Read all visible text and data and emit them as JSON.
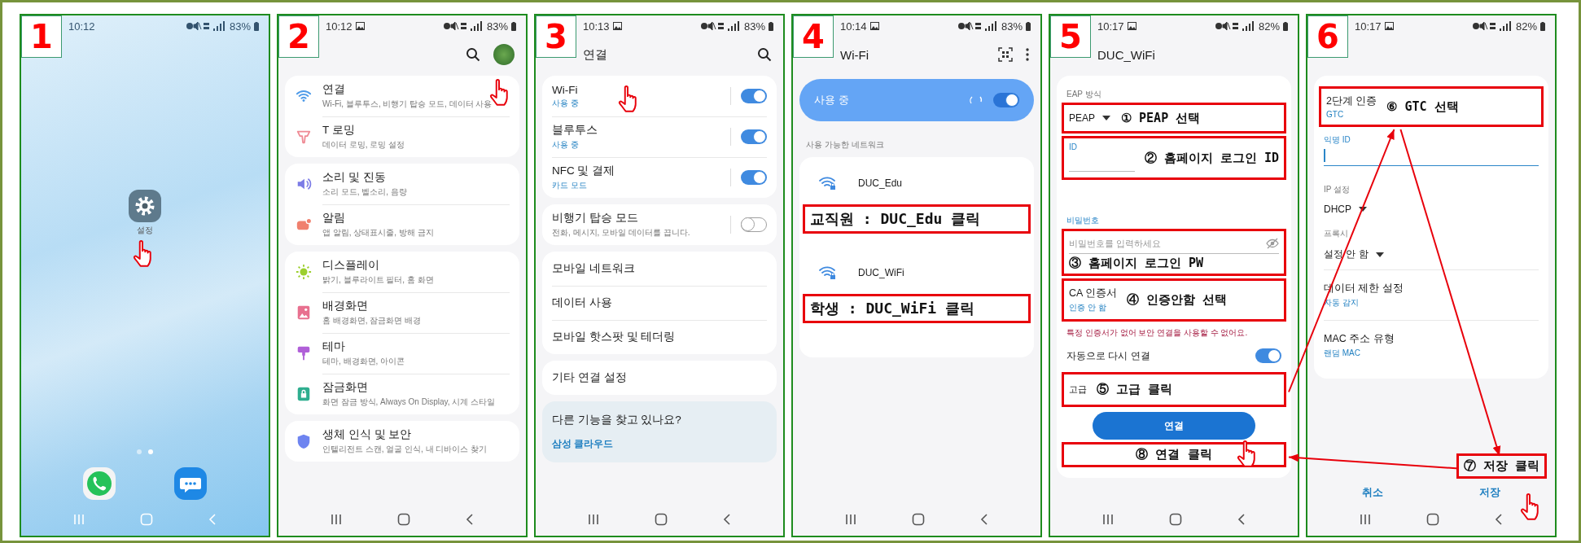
{
  "panels": [
    {
      "kind": "home",
      "number": "1",
      "status_bar": {
        "time": "10:12",
        "battery": "83%"
      },
      "app": {
        "label": "설정",
        "tapped": true
      },
      "page_dots": [
        {
          "selected": false
        },
        {
          "selected": true
        }
      ]
    },
    {
      "kind": "settings",
      "number": "2",
      "status_bar": {
        "time": "10:12",
        "battery": "83%"
      },
      "groups": [
        {
          "items": [
            {
              "title": "연결",
              "subtitle": "Wi-Fi, 블루투스, 비행기 탑승 모드, 데이터 사용",
              "color": "#4f9be8",
              "tapped": true
            },
            {
              "title": "T 로밍",
              "subtitle": "데이터 로밍, 로밍 설정",
              "color": "#ef8a94",
              "tapped": false
            }
          ]
        },
        {
          "items": [
            {
              "title": "소리 및 진동",
              "subtitle": "소리 모드, 벨소리, 음량",
              "color": "#7b7be6",
              "tapped": false
            },
            {
              "title": "알림",
              "subtitle": "앱 알림, 상태표시줄, 방해 금지",
              "color": "#f0806e",
              "tapped": false
            }
          ]
        },
        {
          "items": [
            {
              "title": "디스플레이",
              "subtitle": "밝기, 블루라이트 필터, 홈 화면",
              "color": "#9ccf2e",
              "tapped": false
            },
            {
              "title": "배경화면",
              "subtitle": "홈 배경화면, 잠금화면 배경",
              "color": "#e8708f",
              "tapped": false
            },
            {
              "title": "테마",
              "subtitle": "테마, 배경화면, 아이콘",
              "color": "#b05fd8",
              "tapped": false
            },
            {
              "title": "잠금화면",
              "subtitle": "화면 잠금 방식, Always On Display, 시계 스타일",
              "color": "#2fae8f",
              "tapped": false
            }
          ]
        },
        {
          "items": [
            {
              "title": "생체 인식 및 보안",
              "subtitle": "인텔리전트 스캔, 얼굴 인식, 내 디바이스 찾기",
              "color": "#6e84f0",
              "tapped": false
            }
          ]
        }
      ]
    },
    {
      "kind": "connections",
      "number": "3",
      "status_bar": {
        "time": "10:13",
        "battery": "83%"
      },
      "title": "연결",
      "groups": [
        {
          "items": [
            {
              "kind": "toggle",
              "title": "Wi-Fi",
              "subtitle": "사용 중",
              "on": true,
              "tapped": true
            },
            {
              "kind": "toggle",
              "title": "블루투스",
              "subtitle": "사용 중",
              "on": true,
              "tapped": false
            },
            {
              "kind": "toggle",
              "title": "NFC 및 결제",
              "subtitle": "카드 모드",
              "on": true,
              "tapped": false
            }
          ]
        },
        {
          "items": [
            {
              "kind": "toggle",
              "title": "비행기 탑승 모드",
              "subtitle": "전화, 메시지, 모바일 데이터를 끕니다.",
              "on": false,
              "tapped": false
            }
          ]
        },
        {
          "items": [
            {
              "kind": "link",
              "title": "모바일 네트워크",
              "tapped": false
            },
            {
              "kind": "link",
              "title": "데이터 사용",
              "tapped": false
            },
            {
              "kind": "link",
              "title": "모바일 핫스팟 및 테더링",
              "tapped": false
            }
          ]
        },
        {
          "items": [
            {
              "kind": "link",
              "title": "기타 연결 설정",
              "tapped": false
            }
          ]
        }
      ],
      "suggestion": {
        "question": "다른 기능을 찾고 있나요?",
        "link": "삼성 클라우드"
      }
    },
    {
      "kind": "wifi",
      "number": "4",
      "status_bar": {
        "time": "10:14",
        "battery": "83%"
      },
      "title": "Wi-Fi",
      "master": {
        "label": "사용 중",
        "on": true
      },
      "section": "사용 가능한 네트워크",
      "networks": [
        {
          "name": "DUC_Edu",
          "annotation": "교직원 : DUC_Edu 클릭"
        },
        {
          "name": "DUC_WiFi",
          "annotation": "학생 : DUC_WiFi 클릭"
        }
      ]
    },
    {
      "kind": "form",
      "number": "5",
      "status_bar": {
        "time": "10:17",
        "battery": "82%"
      },
      "title": "DUC_WiFi",
      "rows": [
        {
          "kind": "dropdown",
          "label": "EAP 방식",
          "value": "PEAP",
          "annotation": "① PEAP 선택"
        },
        {
          "kind": "field",
          "label": "ID",
          "focused": false,
          "annotation": "② 홈페이지 로그인 ID"
        },
        {
          "kind": "password",
          "label": "비밀번호",
          "placeholder": "비밀번호를 입력하세요",
          "annotation": "③ 홈페이지 로그인 PW"
        },
        {
          "kind": "setting",
          "title": "CA 인증서",
          "subtitle": "인증 안 함",
          "annotation": "④ 인증안함 선택"
        },
        {
          "kind": "warning",
          "text": "특정 인증서가 없어 보안 연결을 사용할 수 없어요."
        },
        {
          "kind": "switch",
          "title": "자동으로 다시 연결",
          "on": true
        },
        {
          "kind": "link",
          "title": "고급",
          "annotation": "⑤ 고급 클릭"
        },
        {
          "kind": "button",
          "label": "연결",
          "tapped": true,
          "annotation": "⑧ 연결 클릭"
        }
      ]
    },
    {
      "kind": "form",
      "number": "6",
      "status_bar": {
        "time": "10:17",
        "battery": "82%"
      },
      "rows": [
        {
          "kind": "setting",
          "title": "2단계 인증",
          "subtitle": "GTC",
          "annotation": "⑥ GTC 선택"
        },
        {
          "kind": "field",
          "label": "익명 ID",
          "focused": true
        },
        {
          "kind": "dropdown",
          "label": "IP 설정",
          "value": "DHCP"
        },
        {
          "kind": "dropdown",
          "label": "프록시",
          "value": "설정 안 함"
        },
        {
          "kind": "setting",
          "title": "데이터 제한 설정",
          "subtitle": "자동 감지"
        },
        {
          "kind": "setting",
          "title": "MAC 주소 유형",
          "subtitle": "랜덤 MAC"
        }
      ],
      "footer": {
        "annotation": "⑦ 저장 클릭",
        "buttons": [
          {
            "label": "취소",
            "tapped": false
          },
          {
            "label": "저장",
            "tapped": true
          }
        ]
      }
    }
  ]
}
